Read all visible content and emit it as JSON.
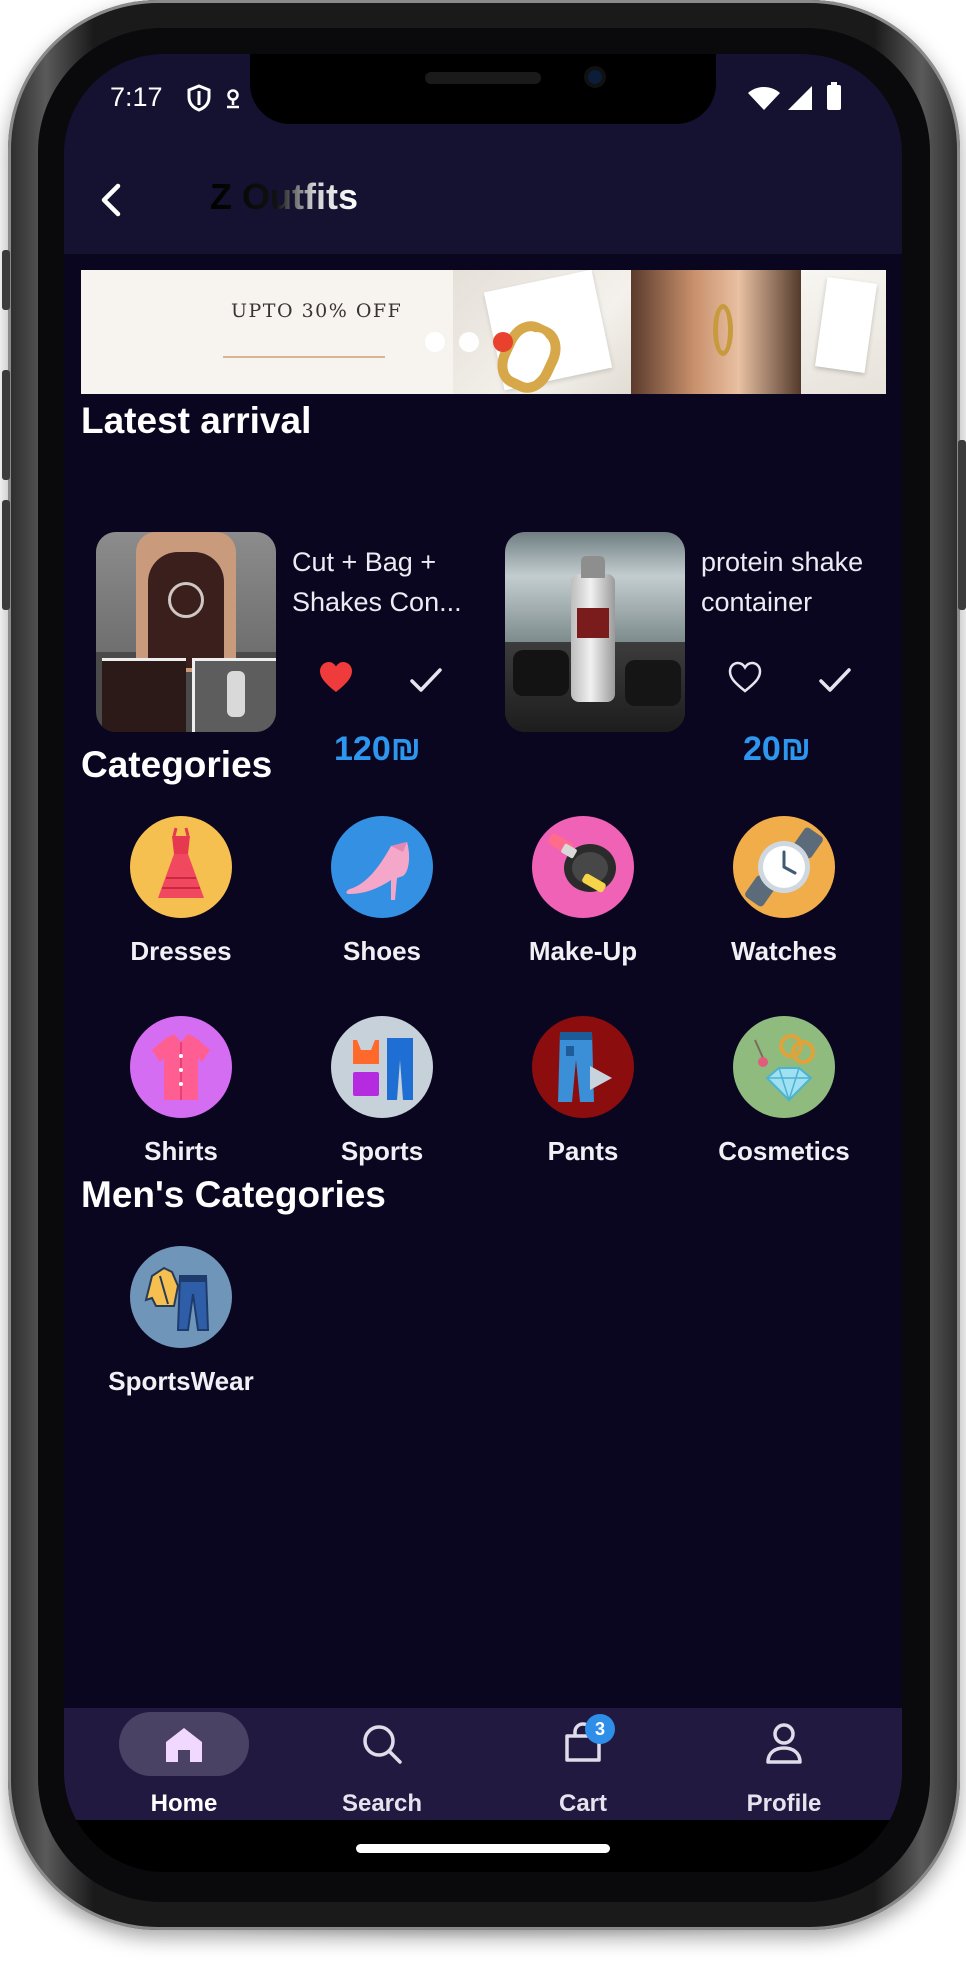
{
  "status_bar": {
    "time": "7:17"
  },
  "app_bar": {
    "title": "Z Outfits"
  },
  "banner": {
    "text": "UPTO 30% OFF",
    "dot_count": 4,
    "active_dot": 3
  },
  "latest_arrival": {
    "heading": "Latest arrival",
    "products": [
      {
        "name": "Cut + Bag + Shakes Con...",
        "price": "120₪",
        "favorited": true
      },
      {
        "name": "protein shake container",
        "price": "20₪",
        "favorited": false
      }
    ]
  },
  "categories": {
    "heading": "Categories",
    "items": [
      {
        "label": "Dresses",
        "color": "#f5c04f",
        "icon": "dress-icon"
      },
      {
        "label": "Shoes",
        "color": "#3490e2",
        "icon": "heel-shoe-icon"
      },
      {
        "label": "Make-Up",
        "color": "#f062b6",
        "icon": "makeup-icon"
      },
      {
        "label": "Watches",
        "color": "#f1ad4a",
        "icon": "watch-icon"
      },
      {
        "label": "Shirts",
        "color": "#d56df2",
        "icon": "shirt-icon"
      },
      {
        "label": "Sports",
        "color": "#c7d1da",
        "icon": "sportswear-icon"
      },
      {
        "label": "Pants",
        "color": "#8b0d0d",
        "icon": "jeans-icon"
      },
      {
        "label": "Cosmetics",
        "color": "#8fbb7e",
        "icon": "jewelry-icon"
      }
    ]
  },
  "mens_categories": {
    "heading": "Men's Categories",
    "items": [
      {
        "label": "SportsWear",
        "color": "#6f95b9",
        "icon": "tracksuit-icon"
      }
    ]
  },
  "bottom_nav": {
    "items": [
      {
        "label": "Home",
        "icon": "home-icon",
        "active": true
      },
      {
        "label": "Search",
        "icon": "search-icon",
        "active": false
      },
      {
        "label": "Cart",
        "icon": "cart-icon",
        "active": false,
        "badge": "3"
      },
      {
        "label": "Profile",
        "icon": "profile-icon",
        "active": false
      }
    ]
  },
  "colors": {
    "background": "#0b0620",
    "app_bar": "#151131",
    "nav_bar": "#221940",
    "price": "#2d97f0",
    "favorite": "#ef3b3b"
  }
}
